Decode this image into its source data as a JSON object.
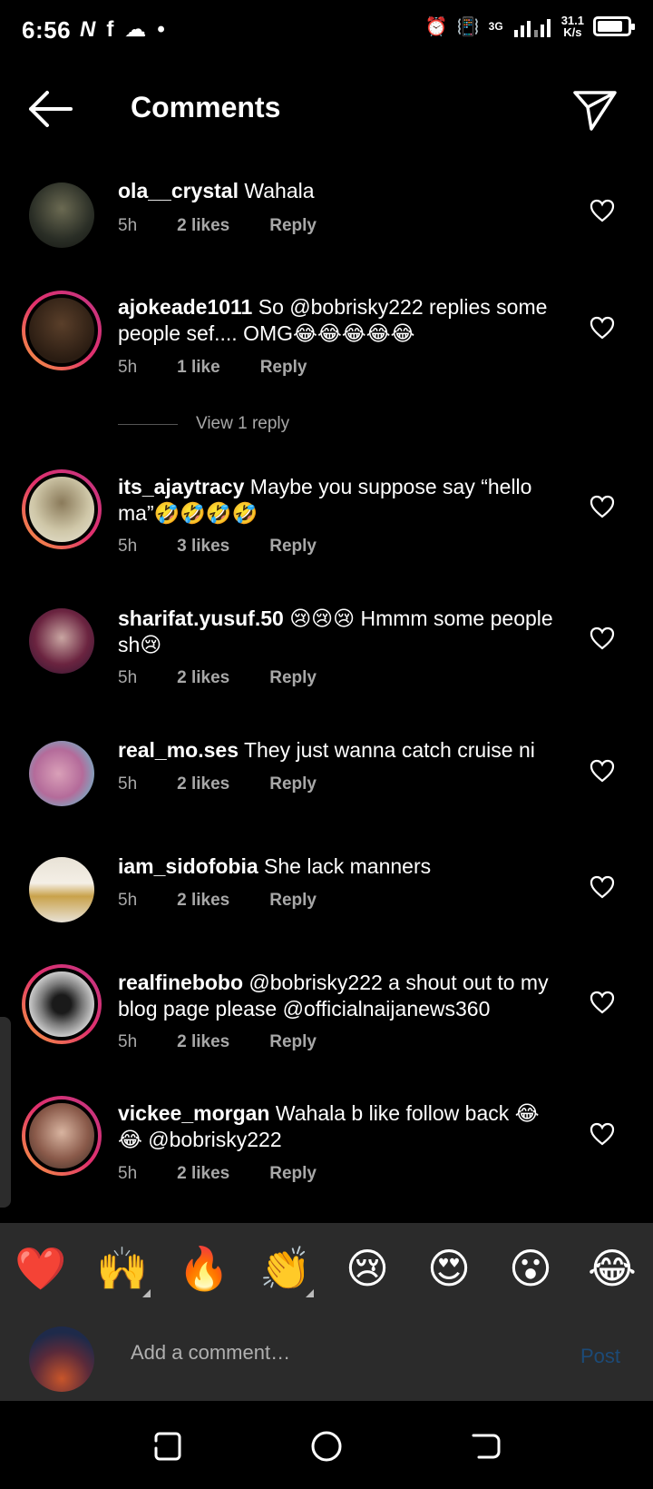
{
  "status_bar": {
    "time": "6:56",
    "left_icons": [
      "N",
      "f",
      "☁",
      "•"
    ],
    "network": "3G",
    "speed_value": "31.1",
    "speed_unit": "K/s",
    "battery_level": 0.85
  },
  "header": {
    "title": "Comments"
  },
  "comments": [
    {
      "user": "ola__crystal",
      "text": "Wahala",
      "time": "5h",
      "likes": "2 likes",
      "reply": "Reply"
    },
    {
      "user": "ajokeade1011",
      "text": "So @bobrisky222 replies some people sef.... OMG😂😂😂😂😂",
      "time": "5h",
      "likes": "1 like",
      "reply": "Reply"
    },
    {
      "user": "its_ajaytracy",
      "text": "Maybe you suppose say “hello ma”🤣🤣🤣🤣",
      "time": "5h",
      "likes": "3 likes",
      "reply": "Reply"
    },
    {
      "user": "sharifat.yusuf.50",
      "text": "😢😢😢 Hmmm some people sh😢",
      "time": "5h",
      "likes": "2 likes",
      "reply": "Reply"
    },
    {
      "user": "real_mo.ses",
      "text": "They just wanna catch cruise ni",
      "time": "5h",
      "likes": "2 likes",
      "reply": "Reply"
    },
    {
      "user": "iam_sidofobia",
      "text": "She lack manners",
      "time": "5h",
      "likes": "2 likes",
      "reply": "Reply"
    },
    {
      "user": "realfinebobo",
      "text": "@bobrisky222 a shout out to my blog page please @officialnaijanews360",
      "time": "5h",
      "likes": "2 likes",
      "reply": "Reply"
    },
    {
      "user": "vickee_morgan",
      "text": "Wahala b like follow back 😂😂 @bobrisky222",
      "time": "5h",
      "likes": "2 likes",
      "reply": "Reply"
    }
  ],
  "view_replies": "View 1 reply",
  "reactions": [
    "❤️",
    "🙌",
    "🔥",
    "👏",
    "😢",
    "😍",
    "😮",
    "😂"
  ],
  "composer": {
    "placeholder": "Add a comment…",
    "post_label": "Post"
  },
  "colors": {
    "background": "#000000",
    "panel": "#2b2b2b",
    "meta_text": "#a8a8a8",
    "post_disabled": "#1c4a77",
    "story_ring_start": "#f9a03f",
    "story_ring_end": "#c13584"
  }
}
